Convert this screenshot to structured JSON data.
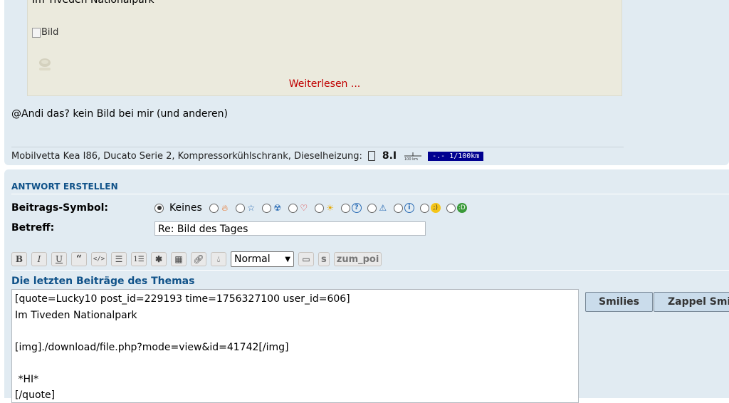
{
  "quote": {
    "title": "Im Tiveden Nationalpark",
    "broken_image_alt": "Bild",
    "read_more": "Weiterlesen ..."
  },
  "post": {
    "text": "@Andi das? kein Bild bei mir (und anderen)"
  },
  "signature": {
    "text": "Mobilvetta Kea I86, Ducato Serie 2, Kompressorkühlschrank, Dieselheizung:",
    "eco_value": "8.I",
    "distance_label": "100 km",
    "consumption": "-.- 1/100km"
  },
  "reply": {
    "heading": "ANTWORT ERSTELLEN",
    "symbol_label": "Beitrags-Symbol:",
    "symbol_none": "Keines",
    "subject_label": "Betreff:",
    "subject_value": "Re: Bild des Tages",
    "font_size_selected": "Normal",
    "toolbar_s": "s",
    "toolbar_zum_poi": "zum_poi",
    "last_posts_label": "Die letzten Beiträge des Themas",
    "message": "[quote=Lucky10 post_id=229193 time=1756327100 user_id=606]\nIm Tiveden Nationalpark\n\n[img]./download/file.php?mode=view&id=41742[/img]\n\n *HI*\n[/quote]",
    "tab_smilies": "Smilies",
    "tab_zappel": "Zappel Smilies"
  },
  "colors": {
    "panel_bg": "#e1ebf2",
    "quote_bg": "#ebeadd",
    "heading_blue": "#105289",
    "link_red": "#c00000",
    "consumption_bg": "#000090"
  }
}
